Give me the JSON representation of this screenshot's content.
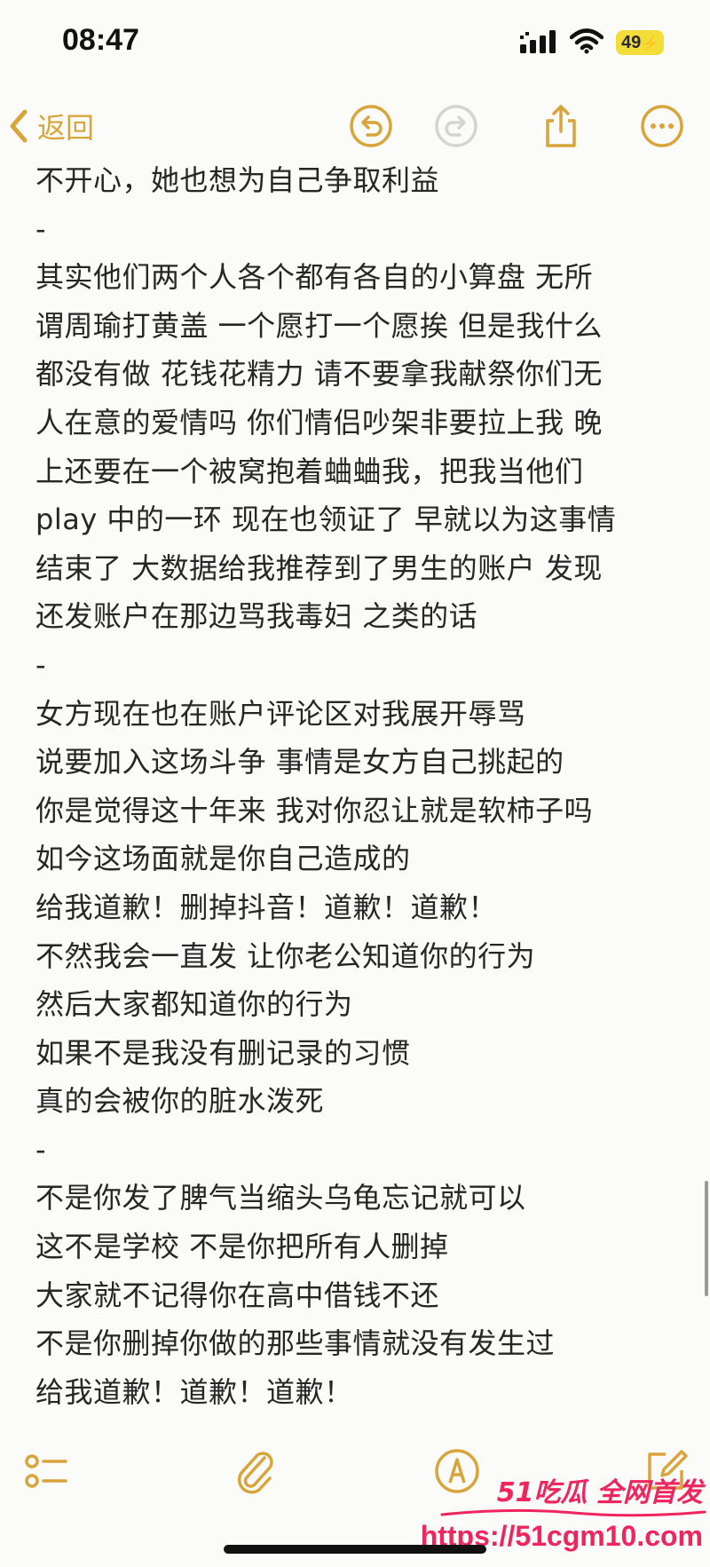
{
  "status_bar": {
    "time": "08:47",
    "battery_level": "49",
    "signal_icon": "cellular-signal-icon",
    "wifi_icon": "wifi-icon",
    "battery_icon": "battery-charging-icon"
  },
  "nav": {
    "back_label": "返回",
    "back_icon": "chevron-left-icon",
    "undo_icon": "undo-icon",
    "redo_icon": "redo-icon",
    "share_icon": "share-icon",
    "more_icon": "more-options-icon",
    "accent_color": "#d8a53a"
  },
  "note": {
    "lines": [
      "不开心，她也想为自己争取利益",
      "-",
      "其实他们两个人各个都有各自的小算盘 无所",
      "谓周瑜打黄盖 一个愿打一个愿挨 但是我什么",
      "都没有做 花钱花精力 请不要拿我献祭你们无",
      "人在意的爱情吗 你们情侣吵架非要拉上我 晚",
      "上还要在一个被窝抱着蛐蛐我，把我当他们",
      "play 中的一环 现在也领证了 早就以为这事情",
      "结束了 大数据给我推荐到了男生的账户 发现",
      "还发账户在那边骂我毒妇 之类的话",
      "-",
      "女方现在也在账户评论区对我展开辱骂",
      "说要加入这场斗争 事情是女方自己挑起的",
      "你是觉得这十年来 我对你忍让就是软柿子吗",
      "如今这场面就是你自己造成的",
      "给我道歉！删掉抖音！道歉！道歉！",
      "不然我会一直发 让你老公知道你的行为",
      "然后大家都知道你的行为",
      "如果不是我没有删记录的习惯",
      "真的会被你的脏水泼死",
      "-",
      "不是你发了脾气当缩头乌龟忘记就可以",
      "这不是学校 不是你把所有人删掉",
      "大家就不记得你在高中借钱不还",
      "不是你删掉你做的那些事情就没有发生过",
      "给我道歉！道歉！道歉！"
    ]
  },
  "toolbar": {
    "checklist_icon": "checklist-icon",
    "attachment_icon": "paperclip-icon",
    "markup_icon": "markup-pen-icon",
    "compose_icon": "compose-icon"
  },
  "watermark": {
    "title": "51吃瓜 全网首发",
    "url": "https://51cgm10.com",
    "color": "#f0255e"
  }
}
